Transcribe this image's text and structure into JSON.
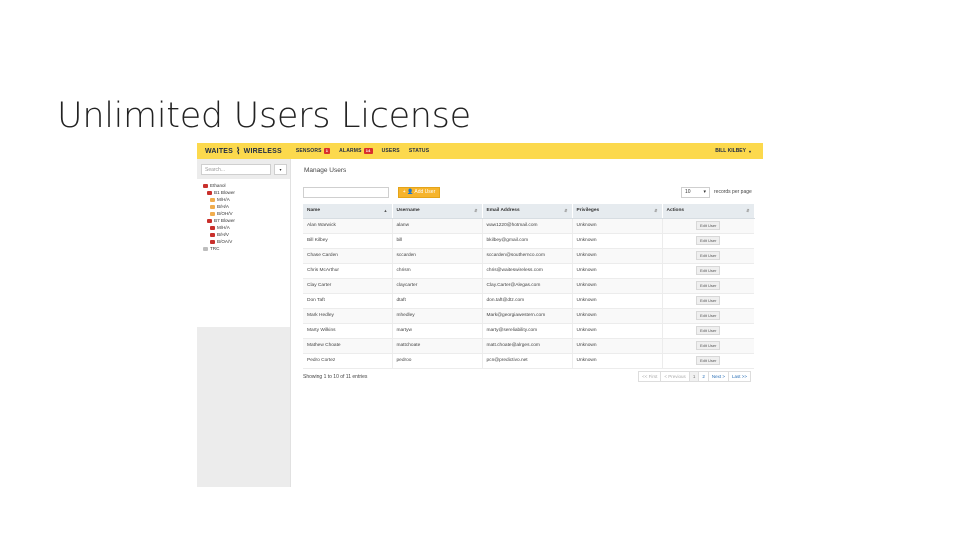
{
  "slide": {
    "title": "Unlimited Users License"
  },
  "app": {
    "brand": {
      "left": "WAITES",
      "right": "WIRELESS"
    },
    "nav": [
      {
        "label": "SENSORS",
        "badge": "1"
      },
      {
        "label": "ALARMS",
        "badge": "14"
      },
      {
        "label": "USERS",
        "badge": ""
      },
      {
        "label": "STATUS",
        "badge": ""
      }
    ],
    "user": {
      "name": "BILL KILBEY",
      "caret": "▾"
    },
    "sidebar": {
      "search_placeholder": "Search...",
      "dropdown_glyph": "▾",
      "tree": [
        {
          "label": "Ethanol",
          "level": 0,
          "status": "red"
        },
        {
          "label": "B1 Blower",
          "level": 1,
          "status": "red"
        },
        {
          "label": "M/H/A",
          "level": 2,
          "status": "yellow"
        },
        {
          "label": "B/H/A",
          "level": 2,
          "status": "yellow"
        },
        {
          "label": "B/OH/V",
          "level": 2,
          "status": "yellow"
        },
        {
          "label": "B7 Blower",
          "level": 1,
          "status": "red"
        },
        {
          "label": "M/H/A",
          "level": 2,
          "status": "red"
        },
        {
          "label": "B/H/V",
          "level": 2,
          "status": "red"
        },
        {
          "label": "B/OA/V",
          "level": 2,
          "status": "red"
        },
        {
          "label": "TRC",
          "level": 0,
          "status": "gray"
        }
      ]
    },
    "main": {
      "page_title": "Manage Users",
      "add_user_label": "+ 👤 Add User",
      "records_per_page": "10",
      "records_label": "records per page",
      "columns": [
        "Name",
        "Username",
        "Email Address",
        "Privileges",
        "Actions"
      ],
      "rows": [
        {
          "name": "Alan Warwick",
          "username": "alanw",
          "email": "waw1220@hotmail.com",
          "privileges": "Unknown",
          "action": "Edit User"
        },
        {
          "name": "Bill Kilbey",
          "username": "bill",
          "email": "bkilbey@gmail.com",
          "privileges": "Unknown",
          "action": "Edit User"
        },
        {
          "name": "Chase Carden",
          "username": "sccarden",
          "email": "sccarden@southernco.com",
          "privileges": "Unknown",
          "action": "Edit User"
        },
        {
          "name": "Chris McArthur",
          "username": "chrism",
          "email": "chris@waiteswireless.com",
          "privileges": "Unknown",
          "action": "Edit User"
        },
        {
          "name": "Clay Carter",
          "username": "claycarter",
          "email": "Clay.Carter@Alegas.com",
          "privileges": "Unknown",
          "action": "Edit User"
        },
        {
          "name": "Don Taft",
          "username": "dtaft",
          "email": "don.taft@dtz.com",
          "privileges": "Unknown",
          "action": "Edit User"
        },
        {
          "name": "Mark Hedley",
          "username": "mhedley",
          "email": "Mark@georgiawestern.com",
          "privileges": "Unknown",
          "action": "Edit User"
        },
        {
          "name": "Marty Wilkins",
          "username": "martyw",
          "email": "marty@sereliability.com",
          "privileges": "Unknown",
          "action": "Edit User"
        },
        {
          "name": "Mathew Choate",
          "username": "mattchoate",
          "email": "matt.choate@alrges.com",
          "privileges": "Unknown",
          "action": "Edit User"
        },
        {
          "name": "Pedro Cortez",
          "username": "pedroo",
          "email": "pcn@predictivo.net",
          "privileges": "Unknown",
          "action": "Edit User"
        }
      ],
      "table_info": "Showing 1 to 10 of 11 entries",
      "pagination": [
        "<< First",
        "< Previous",
        "1",
        "2",
        "Next >",
        "Last >>"
      ],
      "current_page": "1"
    },
    "colors": {
      "topbar": "#fcd94d",
      "add_button": "#f6b42c",
      "badge": "#d9302c",
      "status_red": "#c9302c",
      "status_yellow": "#f0ad4e",
      "status_gray": "#bdbdbd"
    }
  }
}
